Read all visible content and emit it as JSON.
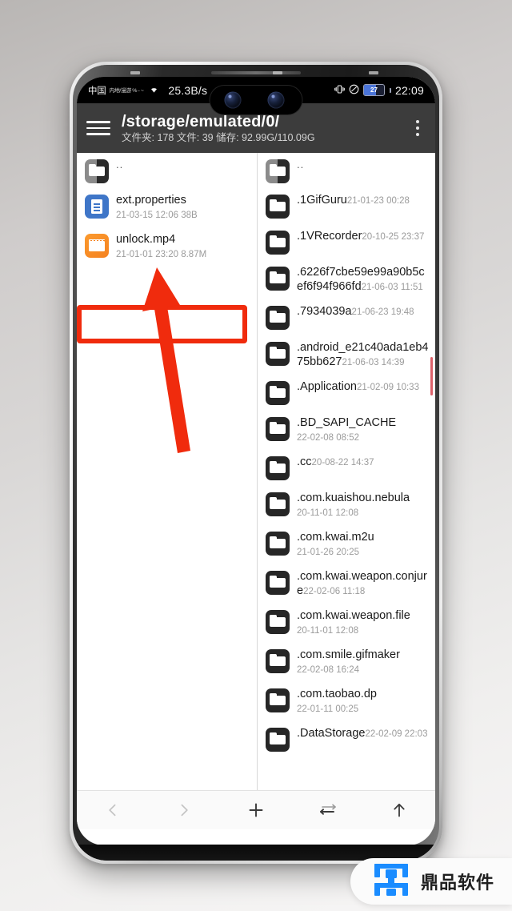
{
  "statusbar": {
    "carrier": "中国",
    "carrier_small": "内地/漫游 % - ~",
    "network_speed": "25.3B/s",
    "vibrate_icon": "vibrate-icon",
    "dnd_icon": "do-not-disturb-icon",
    "battery_percent": "27",
    "time": "22:09"
  },
  "appbar": {
    "menu_icon": "hamburger-menu-icon",
    "path": "/storage/emulated/0/",
    "stats": "文件夹: 178  文件: 39  储存: 92.99G/110.09G",
    "overflow_icon": "more-vertical-icon"
  },
  "left_pane": {
    "items": [
      {
        "icon": "parent-folder-icon",
        "kind": "parent",
        "name": "..",
        "sub": ""
      },
      {
        "icon": "document-file-icon",
        "kind": "doc",
        "name": "ext.properties",
        "sub": "21-03-15 12:06  38B"
      },
      {
        "icon": "video-file-icon",
        "kind": "video",
        "name": "unlock.mp4",
        "sub": "21-01-01 23:20  8.87M"
      }
    ]
  },
  "right_pane": {
    "items": [
      {
        "icon": "parent-folder-icon",
        "kind": "parent",
        "name": "..",
        "sub": ""
      },
      {
        "icon": "folder-icon",
        "kind": "folder",
        "name": ".1GifGuru",
        "sub": "21-01-23 00:28"
      },
      {
        "icon": "folder-icon",
        "kind": "folder",
        "name": ".1VRecorder",
        "sub": "20-10-25 23:37"
      },
      {
        "icon": "folder-icon",
        "kind": "folder",
        "name": ".6226f7cbe59e99a90b5cef6f94f966fd",
        "sub": "21-06-03 11:51"
      },
      {
        "icon": "folder-icon",
        "kind": "folder",
        "name": ".7934039a",
        "sub": "21-06-23 19:48"
      },
      {
        "icon": "folder-icon",
        "kind": "folder",
        "name": ".android_e21c40ada1eb475bb627",
        "sub": "21-06-03 14:39"
      },
      {
        "icon": "folder-icon",
        "kind": "folder",
        "name": ".Application",
        "sub": "21-02-09 10:33"
      },
      {
        "icon": "folder-icon",
        "kind": "folder",
        "name": ".BD_SAPI_CACHE",
        "sub": "22-02-08 08:52"
      },
      {
        "icon": "folder-icon",
        "kind": "folder",
        "name": ".cc",
        "sub": "20-08-22 14:37"
      },
      {
        "icon": "folder-icon",
        "kind": "folder",
        "name": ".com.kuaishou.nebula",
        "sub": "20-11-01 12:08"
      },
      {
        "icon": "folder-icon",
        "kind": "folder",
        "name": ".com.kwai.m2u",
        "sub": "21-01-26 20:25"
      },
      {
        "icon": "folder-icon",
        "kind": "folder",
        "name": ".com.kwai.weapon.conjure",
        "sub": "22-02-06 11:18"
      },
      {
        "icon": "folder-icon",
        "kind": "folder",
        "name": ".com.kwai.weapon.file",
        "sub": "20-11-01 12:08"
      },
      {
        "icon": "folder-icon",
        "kind": "folder",
        "name": ".com.smile.gifmaker",
        "sub": "22-02-08 16:24"
      },
      {
        "icon": "folder-icon",
        "kind": "folder",
        "name": ".com.taobao.dp",
        "sub": "22-01-11 00:25"
      },
      {
        "icon": "folder-icon",
        "kind": "folder",
        "name": ".DataStorage",
        "sub": "22-02-09 22:03"
      }
    ]
  },
  "toolbar": {
    "buttons": [
      {
        "name": "back-button",
        "icon": "chevron-left-icon",
        "enabled": false
      },
      {
        "name": "forward-button",
        "icon": "chevron-right-icon",
        "enabled": false
      },
      {
        "name": "add-button",
        "icon": "plus-icon",
        "enabled": true
      },
      {
        "name": "swap-panes-button",
        "icon": "swap-arrows-icon",
        "enabled": true
      },
      {
        "name": "go-up-button",
        "icon": "arrow-up-icon",
        "enabled": true
      }
    ]
  },
  "annotations": {
    "highlight_color": "#f02b0d",
    "arrow_color": "#f02b0d",
    "highlight_target": "unlock.mp4"
  },
  "watermark": {
    "logo_icon": "dingpin-logo-icon",
    "text": "鼎品软件",
    "logo_color": "#1a8cff"
  }
}
